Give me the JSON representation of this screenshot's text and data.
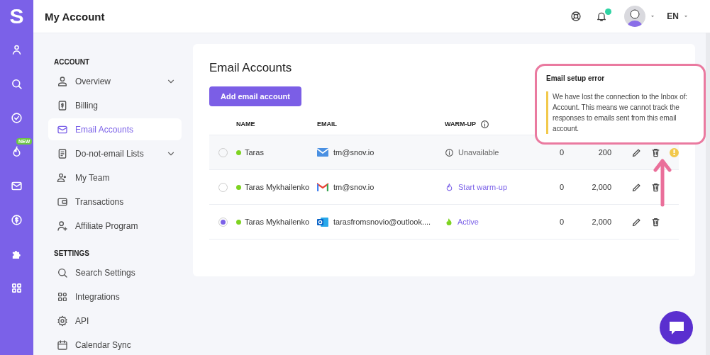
{
  "rail": {
    "logo": "S",
    "badge": "NEW"
  },
  "topbar": {
    "title": "My Account",
    "has_notifications": true,
    "language": "EN"
  },
  "sidebar": {
    "sections": [
      {
        "title": "ACCOUNT",
        "items": [
          {
            "label": "Overview",
            "kind": "group",
            "selected": false
          },
          {
            "label": "Billing",
            "kind": "link",
            "selected": false
          },
          {
            "label": "Email Accounts",
            "kind": "link",
            "selected": true
          },
          {
            "label": "Do-not-email Lists",
            "kind": "group",
            "selected": false
          },
          {
            "label": "My Team",
            "kind": "link",
            "selected": false
          },
          {
            "label": "Transactions",
            "kind": "link",
            "selected": false
          },
          {
            "label": "Affiliate Program",
            "kind": "link",
            "selected": false
          }
        ]
      },
      {
        "title": "SETTINGS",
        "items": [
          {
            "label": "Search Settings",
            "kind": "link",
            "selected": false
          },
          {
            "label": "Integrations",
            "kind": "link",
            "selected": false
          },
          {
            "label": "API",
            "kind": "link",
            "selected": false
          },
          {
            "label": "Calendar Sync",
            "kind": "link",
            "selected": false
          }
        ]
      }
    ]
  },
  "content": {
    "title": "Email Accounts",
    "add_button": "Add email account",
    "table": {
      "columns": [
        "NAME",
        "EMAIL",
        "WARM-UP"
      ],
      "rows": [
        {
          "selected": false,
          "highlighted": true,
          "active": true,
          "name": "Taras",
          "provider": {
            "kind": "mail"
          },
          "email": "tm@snov.io",
          "warmup": {
            "kind": "unavailable",
            "label": "Unavailable"
          },
          "column_4": "0",
          "column_5": "200",
          "warning": true
        },
        {
          "selected": false,
          "highlighted": false,
          "active": true,
          "name": "Taras Mykhailenko",
          "provider": {
            "kind": "gmail"
          },
          "email": "tm@snov.io",
          "warmup": {
            "kind": "start",
            "label": "Start warm-up"
          },
          "column_4": "0",
          "column_5": "2,000",
          "warning": false
        },
        {
          "selected": true,
          "highlighted": false,
          "active": true,
          "name": "Taras Mykhailenko",
          "provider": {
            "kind": "outlook"
          },
          "email": "tarasfromsnovio@outlook....",
          "warmup": {
            "kind": "active",
            "label": "Active"
          },
          "column_4": "0",
          "column_5": "2,000",
          "warning": false
        }
      ]
    }
  },
  "tooltip": {
    "title": "Email setup error",
    "body": "We have lost the connection to the Inbox of: Account. This means we cannot track the responses to emails sent from this email account."
  }
}
